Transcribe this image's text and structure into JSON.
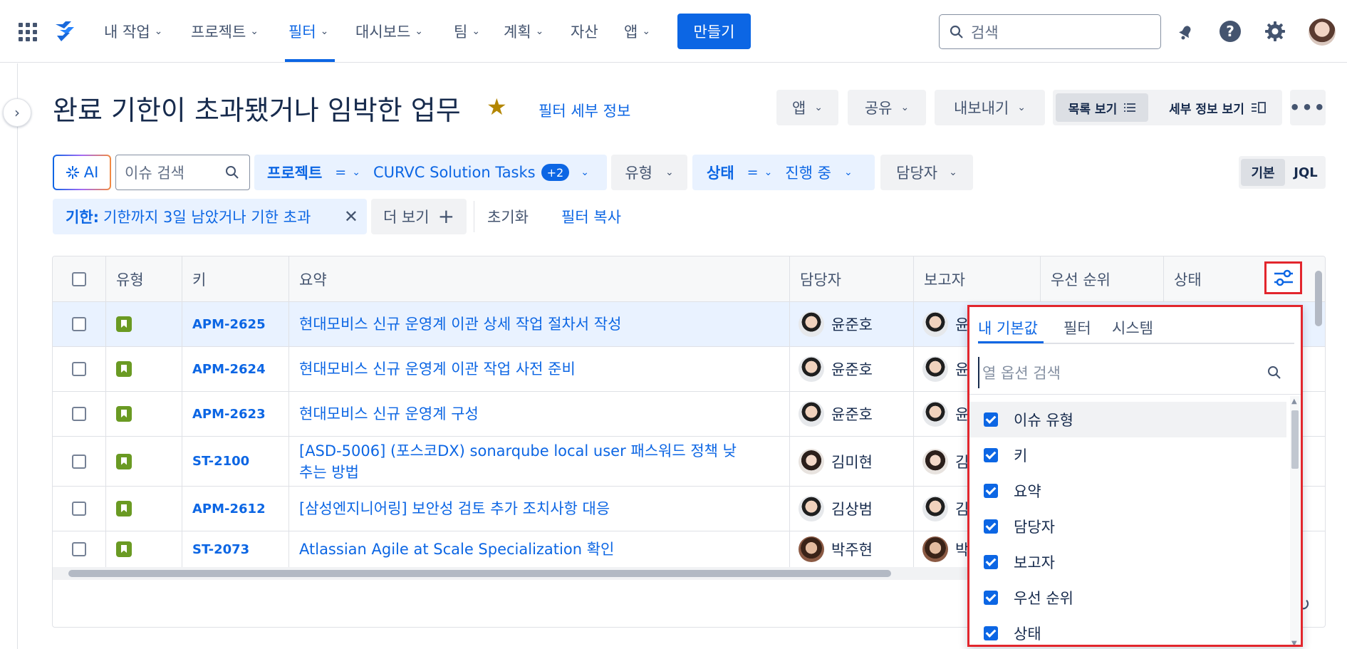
{
  "nav": {
    "items": [
      {
        "label": "내 작업",
        "chevron": true
      },
      {
        "label": "프로젝트",
        "chevron": true
      },
      {
        "label": "필터",
        "chevron": true,
        "active": true
      },
      {
        "label": "대시보드",
        "chevron": true
      },
      {
        "label": "팀",
        "chevron": true
      },
      {
        "label": "계획",
        "chevron": true
      },
      {
        "label": "자산",
        "chevron": false
      },
      {
        "label": "앱",
        "chevron": true
      }
    ],
    "create_label": "만들기",
    "search_placeholder": "검색"
  },
  "header": {
    "title": "완료 기한이 초과됐거나 임박한 업무",
    "filter_details": "필터 세부 정보",
    "apps": "앱",
    "share": "공유",
    "export": "내보내기",
    "list_view": "목록 보기",
    "detail_view": "세부 정보 보기"
  },
  "filters": {
    "ai_label": "AI",
    "issue_search_placeholder": "이슈 검색",
    "project_label": "프로젝트",
    "project_op": "=",
    "project_value": "CURVC Solution Tasks",
    "project_extra": "+2",
    "type_label": "유형",
    "status_label": "상태",
    "status_op": "=",
    "status_value": "진행 중",
    "assignee_label": "담당자",
    "mode_basic": "기본",
    "mode_jql": "JQL",
    "due_label": "기한:",
    "due_value": "기한까지 3일 남았거나 기한 초과",
    "more": "더 보기",
    "reset": "초기화",
    "copy_filter": "필터 복사"
  },
  "table": {
    "columns": [
      "유형",
      "키",
      "요약",
      "담당자",
      "보고자",
      "우선 순위",
      "상태"
    ],
    "rows": [
      {
        "key": "APM-2625",
        "summary": "현대모비스 신규 운영계 이관 상세 작업 절차서 작성",
        "assignee": "윤준호",
        "reporter": "윤"
      },
      {
        "key": "APM-2624",
        "summary": "현대모비스 신규 운영계 이관 작업 사전 준비",
        "assignee": "윤준호",
        "reporter": "윤"
      },
      {
        "key": "APM-2623",
        "summary": "현대모비스 신규 운영계 구성",
        "assignee": "윤준호",
        "reporter": "윤"
      },
      {
        "key": "ST-2100",
        "summary": "[ASD-5006] (포스코DX) sonarqube local user 패스워드 정책 낮추는 방법",
        "assignee": "김미현",
        "reporter": "김"
      },
      {
        "key": "APM-2612",
        "summary": "[삼성엔지니어링] 보안성 검토 추가 조치사항 대응",
        "assignee": "김상범",
        "reporter": "김"
      },
      {
        "key": "ST-2073",
        "summary": "Atlassian Agile at Scale Specialization 확인",
        "assignee": "박주현",
        "reporter": "박"
      }
    ]
  },
  "column_settings": {
    "tabs": [
      "내 기본값",
      "필터",
      "시스템"
    ],
    "search_placeholder": "열 옵션 검색",
    "options": [
      "이슈 유형",
      "키",
      "요약",
      "담당자",
      "보고자",
      "우선 순위",
      "상태"
    ]
  },
  "colors": {
    "accent": "#0c66e4",
    "highlight_border": "#e2262d",
    "story_icon": "#6a9a23"
  }
}
